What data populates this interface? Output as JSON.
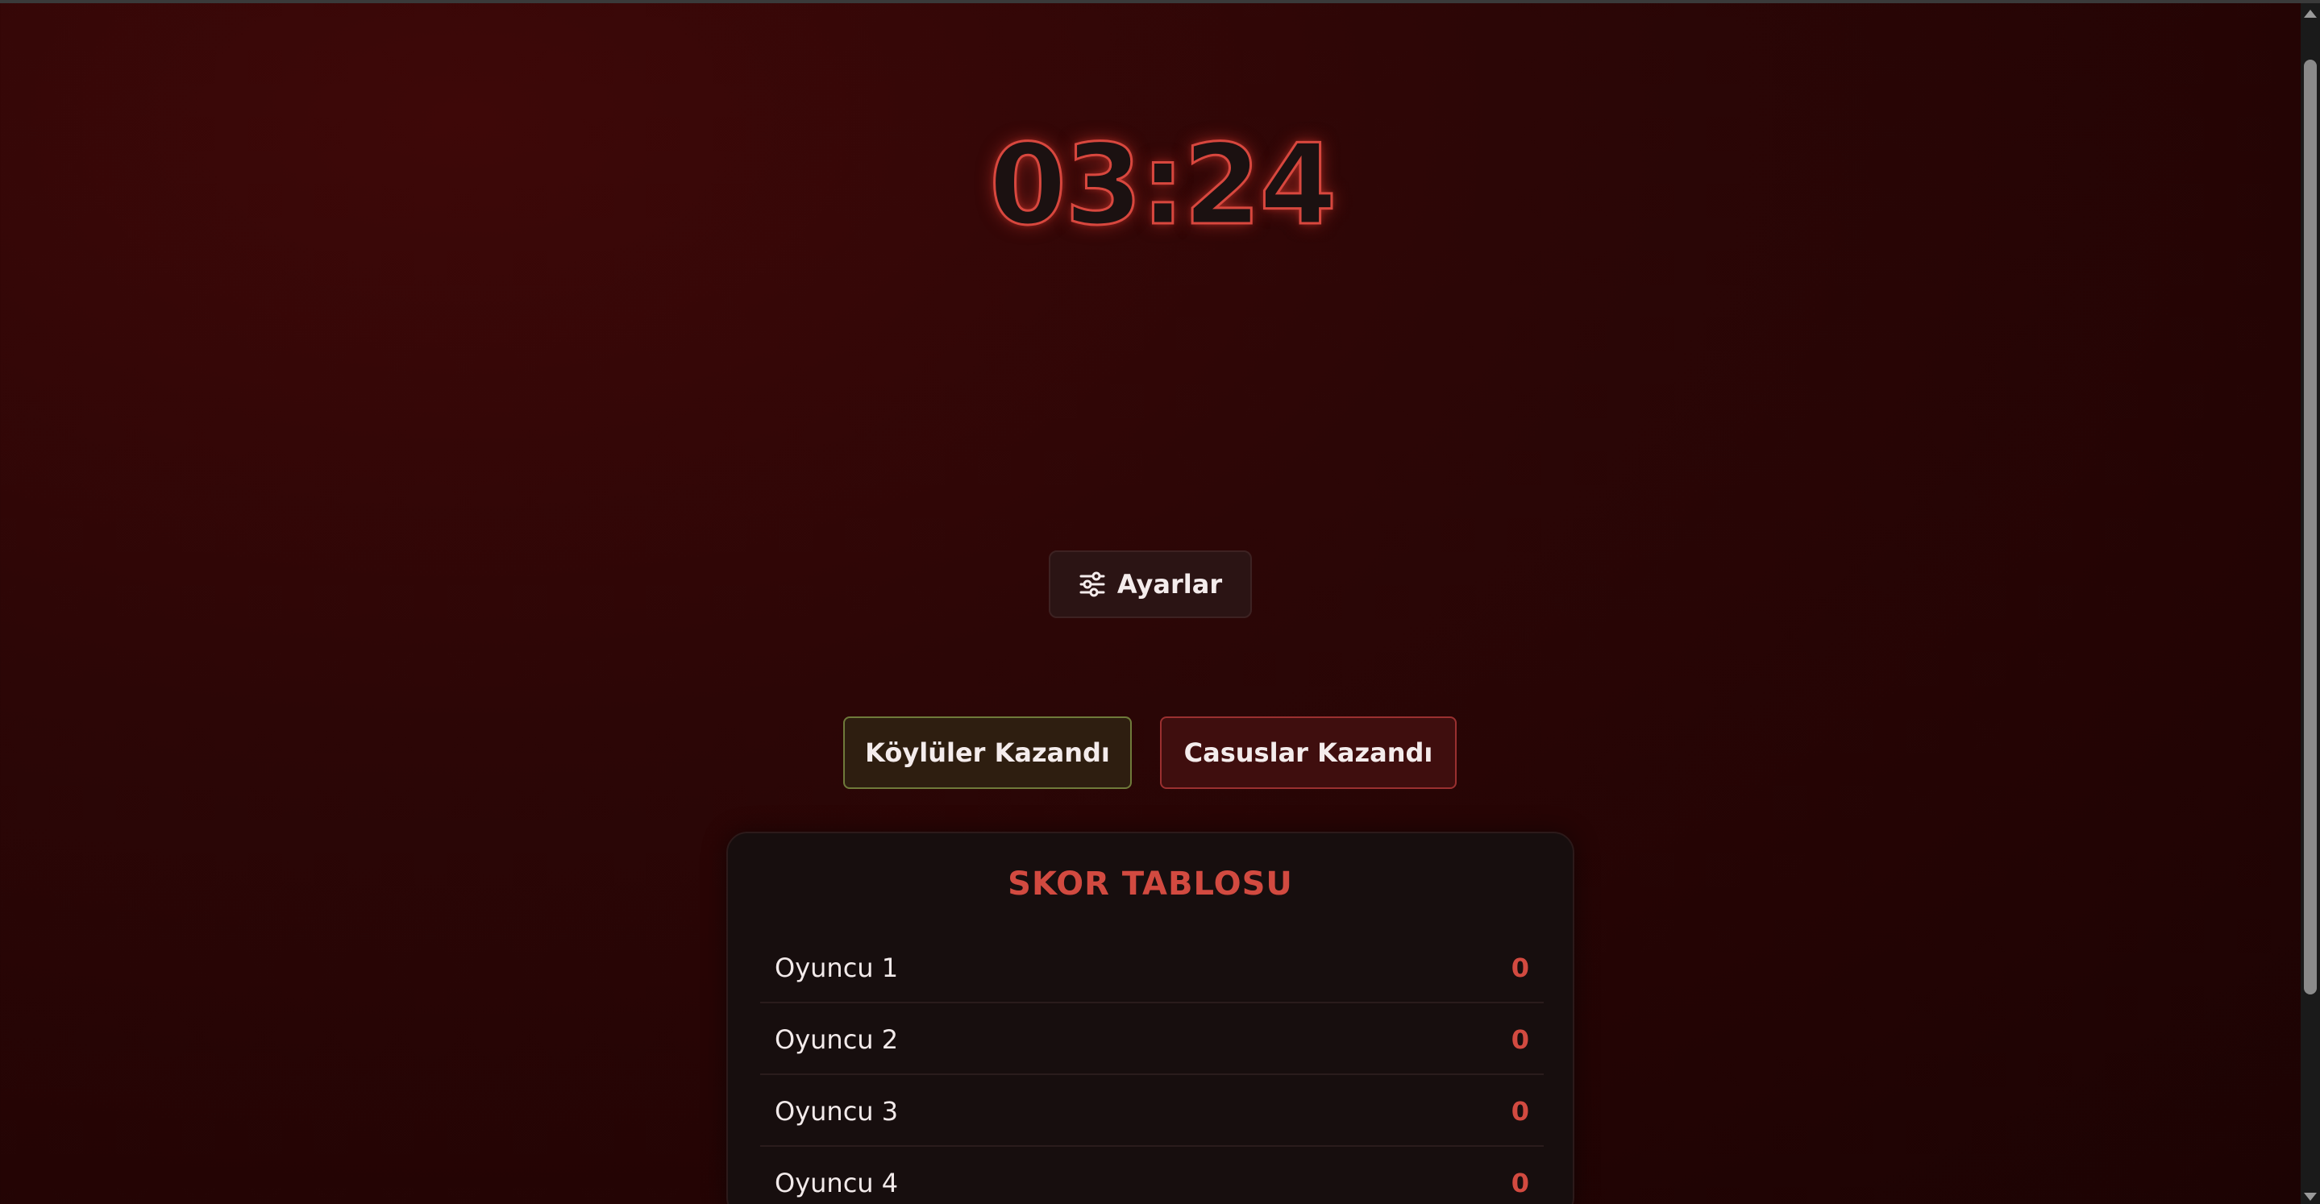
{
  "timer": {
    "display": "03:24"
  },
  "settings": {
    "label": "Ayarlar",
    "icon": "sliders-icon"
  },
  "actions": {
    "villagers_win": "Köylüler Kazandı",
    "spies_win": "Casuslar Kazandı"
  },
  "scoreboard": {
    "title": "SKOR TABLOSU",
    "players": [
      {
        "name": "Oyuncu 1",
        "score": "0"
      },
      {
        "name": "Oyuncu 2",
        "score": "0"
      },
      {
        "name": "Oyuncu 3",
        "score": "0"
      },
      {
        "name": "Oyuncu 4",
        "score": "0"
      }
    ]
  },
  "colors": {
    "accent": "#d24a40",
    "background": "#2c0606",
    "card": "#170e0e",
    "villagers_border": "#6f7a3a",
    "spies_border": "#9a3030"
  }
}
